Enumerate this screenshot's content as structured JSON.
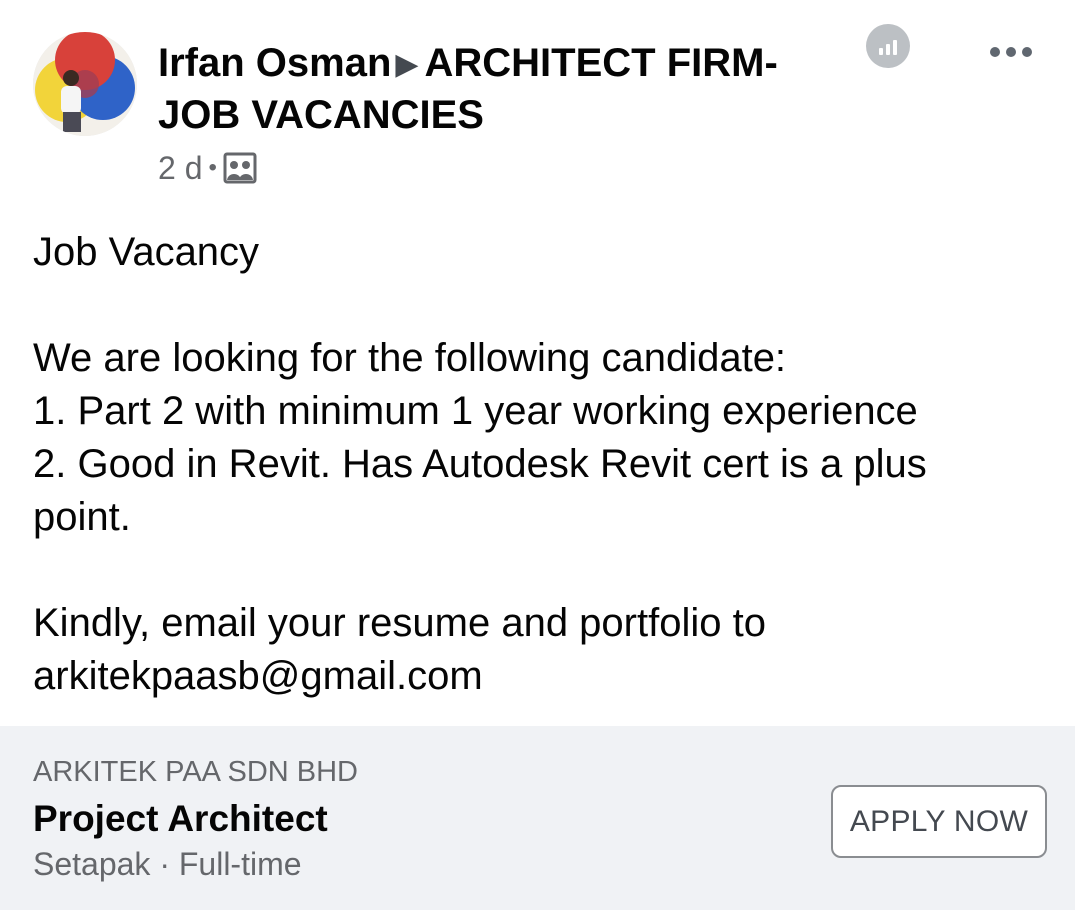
{
  "post": {
    "author": "Irfan Osman",
    "group": "ARCHITECT FIRM-JOB VACANCIES",
    "timestamp": "2 d",
    "separator": "•",
    "audience_icon": "group-icon",
    "insights_icon": "insights-icon",
    "more_icon": "more-options-icon",
    "body": {
      "line1": "Job Vacancy",
      "line2": "We are looking for the following candidate:",
      "line3": "1. Part 2 with minimum 1 year working experience",
      "line4": "2. Good in Revit. Has Autodesk Revit cert is a plus point.",
      "line5": "Kindly, email your resume and portfolio to arkitekpaasb@gmail.com"
    }
  },
  "job_card": {
    "company": "ARKITEK PAA SDN BHD",
    "title": "Project Architect",
    "details": "Setapak · Full-time",
    "apply_label": "APPLY NOW"
  },
  "colors": {
    "text_primary": "#050505",
    "text_secondary": "#65676b",
    "card_background": "#f0f2f5",
    "button_border": "#8a8d91"
  }
}
